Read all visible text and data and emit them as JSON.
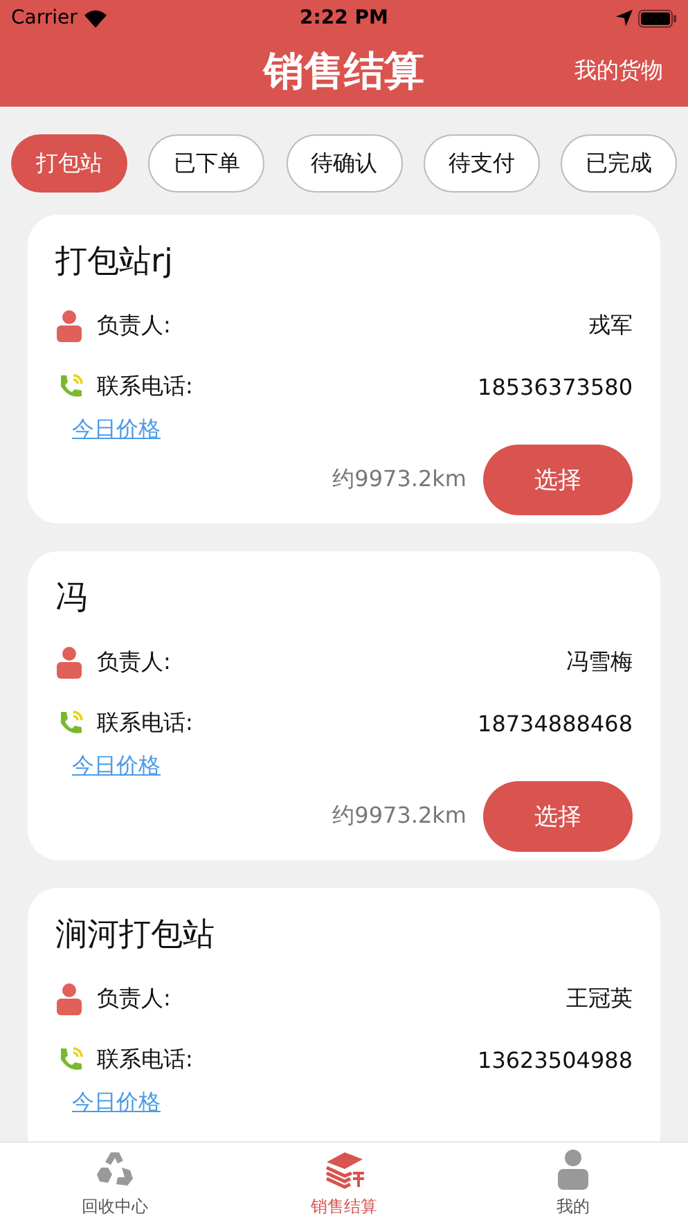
{
  "status_bar": {
    "carrier": "Carrier",
    "time": "2:22 PM"
  },
  "header": {
    "title": "销售结算",
    "action": "我的货物"
  },
  "filters": [
    {
      "label": "打包站",
      "selected": true
    },
    {
      "label": "已下单",
      "selected": false
    },
    {
      "label": "待确认",
      "selected": false
    },
    {
      "label": "待支付",
      "selected": false
    },
    {
      "label": "已完成",
      "selected": false
    }
  ],
  "stations": [
    {
      "name": "打包站rj",
      "manager_label": "负责人:",
      "manager": "戎军",
      "phone_label": "联系电话:",
      "phone": "18536373580",
      "price_link": "今日价格",
      "distance": "约9973.2km",
      "button": "选择"
    },
    {
      "name": "冯",
      "manager_label": "负责人:",
      "manager": "冯雪梅",
      "phone_label": "联系电话:",
      "phone": "18734888468",
      "price_link": "今日价格",
      "distance": "约9973.2km",
      "button": "选择"
    },
    {
      "name": "涧河打包站",
      "manager_label": "负责人:",
      "manager": "王冠英",
      "phone_label": "联系电话:",
      "phone": "13623504988",
      "price_link": "今日价格"
    }
  ],
  "tab_bar": [
    {
      "label": "回收中心",
      "selected": false,
      "kind": "recycle"
    },
    {
      "label": "销售结算",
      "selected": true,
      "kind": "books"
    },
    {
      "label": "我的",
      "selected": false,
      "kind": "person"
    }
  ]
}
